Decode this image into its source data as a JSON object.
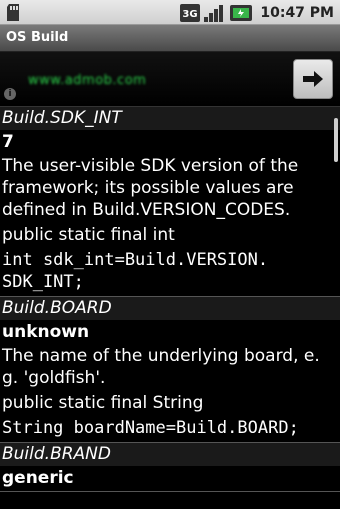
{
  "statusbar": {
    "time": "10:47 PM",
    "network_label": "3G"
  },
  "titlebar": {
    "title": "OS Build"
  },
  "ad": {
    "text": "www.admob.com",
    "info_glyph": "i"
  },
  "entries": [
    {
      "name": "Build.SDK_INT",
      "value": "7",
      "desc": "The user-visible SDK version of the framework; its possible values are defined in Build.VERSION_CODES.",
      "decl": "public static final int",
      "code": "int sdk_int=Build.VERSION.\nSDK_INT;"
    },
    {
      "name": "Build.BOARD",
      "value": "unknown",
      "desc": "The name of the underlying board, e. g. 'goldfish'.",
      "decl": "public static final String",
      "code": "String boardName=Build.BOARD;"
    },
    {
      "name": "Build.BRAND",
      "value": "generic"
    }
  ]
}
